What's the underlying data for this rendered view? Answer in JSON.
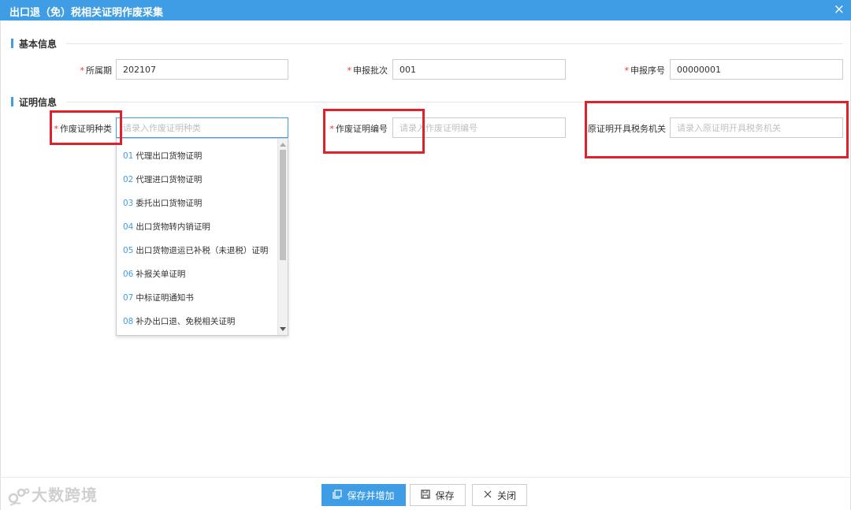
{
  "window": {
    "title": "出口退（免）税相关证明作废采集",
    "close_glyph": "×"
  },
  "sections": {
    "basic": "基本信息",
    "cert": "证明信息"
  },
  "basic": {
    "period": {
      "label": "所属期",
      "value": "202107"
    },
    "batch": {
      "label": "申报批次",
      "value": "001"
    },
    "serial": {
      "label": "申报序号",
      "value": "00000001"
    }
  },
  "cert": {
    "type": {
      "label": "作废证明种类",
      "placeholder": "请录入作废证明种类"
    },
    "number": {
      "label": "作废证明编号",
      "placeholder": "请录入作废证明编号"
    },
    "authority": {
      "label": "原证明开具税务机关",
      "placeholder": "请录入原证明开具税务机关"
    }
  },
  "required_mark": "*",
  "dropdown": {
    "options": [
      {
        "code": "01",
        "text": "代理出口货物证明"
      },
      {
        "code": "02",
        "text": "代理进口货物证明"
      },
      {
        "code": "03",
        "text": "委托出口货物证明"
      },
      {
        "code": "04",
        "text": "出口货物转内销证明"
      },
      {
        "code": "05",
        "text": "出口货物退运已补税（未退税）证明"
      },
      {
        "code": "06",
        "text": "补报关单证明"
      },
      {
        "code": "07",
        "text": "中标证明通知书"
      },
      {
        "code": "08",
        "text": "补办出口退、免税相关证明"
      }
    ]
  },
  "footer": {
    "save_add": "保存并增加",
    "save": "保存",
    "close": "关闭"
  },
  "watermark": "大数跨境",
  "colors": {
    "accent": "#3f9de6",
    "highlight": "#e0202a",
    "required": "#ee3333"
  },
  "icons": {
    "save_add": "copy-icon",
    "save": "floppy-icon",
    "close": "x-icon"
  }
}
